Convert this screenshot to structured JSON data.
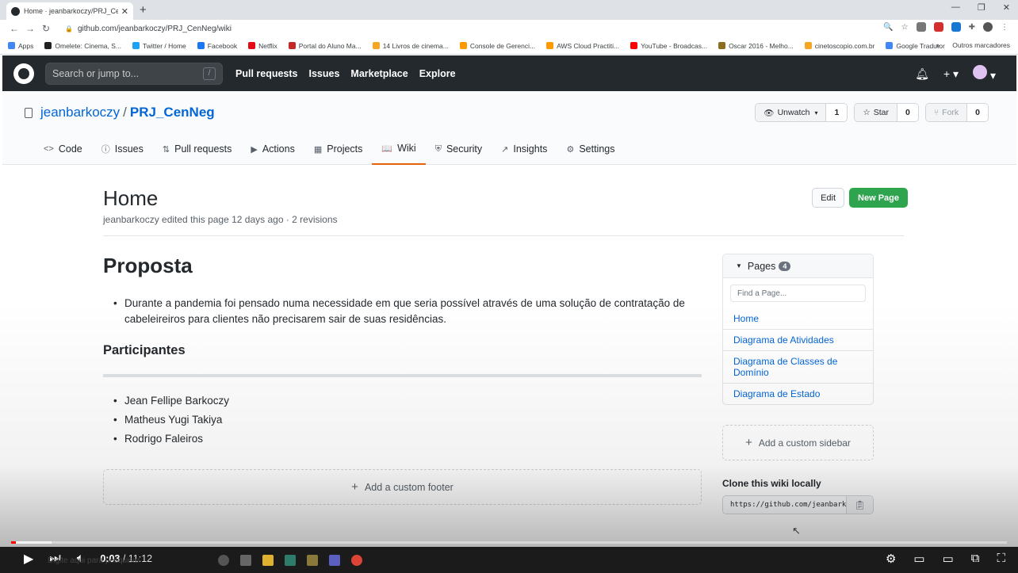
{
  "browser": {
    "tab_title": "Home · jeanbarkoczy/PRJ_CenNeg",
    "tab_close": "✕",
    "new_tab": "+",
    "url": "github.com/jeanbarkoczy/PRJ_CenNeg/wiki",
    "bookmarks": [
      {
        "label": "Apps",
        "color": "#4285f4"
      },
      {
        "label": "Omelete: Cinema, S...",
        "color": "#222222"
      },
      {
        "label": "Twitter / Home",
        "color": "#1da1f2"
      },
      {
        "label": "Facebook",
        "color": "#1877f2"
      },
      {
        "label": "Netflix",
        "color": "#e50914"
      },
      {
        "label": "Portal do Aluno Ma...",
        "color": "#c62828"
      },
      {
        "label": "14 Livros de cinema...",
        "color": "#f5a623"
      },
      {
        "label": "Console de Gerenci...",
        "color": "#ff9900"
      },
      {
        "label": "AWS Cloud Practiti...",
        "color": "#ff9900"
      },
      {
        "label": "YouTube - Broadcas...",
        "color": "#ff0000"
      },
      {
        "label": "Oscar 2016 - Melho...",
        "color": "#8a6d1e"
      },
      {
        "label": "cinetoscopio.com.br",
        "color": "#f5a623"
      },
      {
        "label": "Google Tradutor",
        "color": "#4285f4"
      }
    ],
    "bookmarks_more": "»",
    "other_bookmarks": "Outros marcadores"
  },
  "github": {
    "search_placeholder": "Search or jump to...",
    "search_shortcut": "/",
    "nav": [
      "Pull requests",
      "Issues",
      "Marketplace",
      "Explore"
    ]
  },
  "repo": {
    "owner": "jeanbarkoczy",
    "separator": "/",
    "name": "PRJ_CenNeg",
    "unwatch_label": "Unwatch",
    "unwatch_count": "1",
    "star_label": "Star",
    "star_count": "0",
    "fork_label": "Fork",
    "fork_count": "0",
    "tabs": [
      {
        "icon": "<>",
        "label": "Code"
      },
      {
        "icon": "ⓘ",
        "label": "Issues"
      },
      {
        "icon": "⇅",
        "label": "Pull requests"
      },
      {
        "icon": "▶",
        "label": "Actions"
      },
      {
        "icon": "▦",
        "label": "Projects"
      },
      {
        "icon": "📖",
        "label": "Wiki"
      },
      {
        "icon": "⛨",
        "label": "Security"
      },
      {
        "icon": "↗",
        "label": "Insights"
      },
      {
        "icon": "⚙",
        "label": "Settings"
      }
    ],
    "selected_tab": "Wiki"
  },
  "wiki": {
    "title": "Home",
    "meta": "jeanbarkoczy edited this page 12 days ago · 2 revisions",
    "edit_label": "Edit",
    "new_page_label": "New Page",
    "heading": "Proposta",
    "proposal": "Durante a pandemia foi pensado numa necessidade em que seria possível através de uma solução de contratação de cabeleireiros para clientes não precisarem sair de suas residências.",
    "participants_heading": "Participantes",
    "participants": [
      "Jean Fellipe Barkoczy",
      "Matheus Yugi Takiya",
      "Rodrigo Faleiros"
    ],
    "custom_footer": "Add a custom footer",
    "pages_label": "Pages",
    "pages_count": "4",
    "find_placeholder": "Find a Page...",
    "pages": [
      "Home",
      "Diagrama de Atividades",
      "Diagrama de Classes de Domínio",
      "Diagrama de Estado"
    ],
    "custom_sidebar": "Add a custom sidebar",
    "clone_title": "Clone this wiki locally",
    "clone_url": "https://github.com/jeanbarkoczy/PRJ_CenNeg.wiki.git"
  },
  "video": {
    "current": "0:03",
    "separator": " / ",
    "duration": "11:12",
    "taskbar_search": "Digite aqui para pesquisar"
  },
  "colors": {
    "accent": "#0366d6",
    "primary_button": "#2ea44f",
    "selected_tab_border": "#e36209",
    "header_bg": "#24292e"
  }
}
